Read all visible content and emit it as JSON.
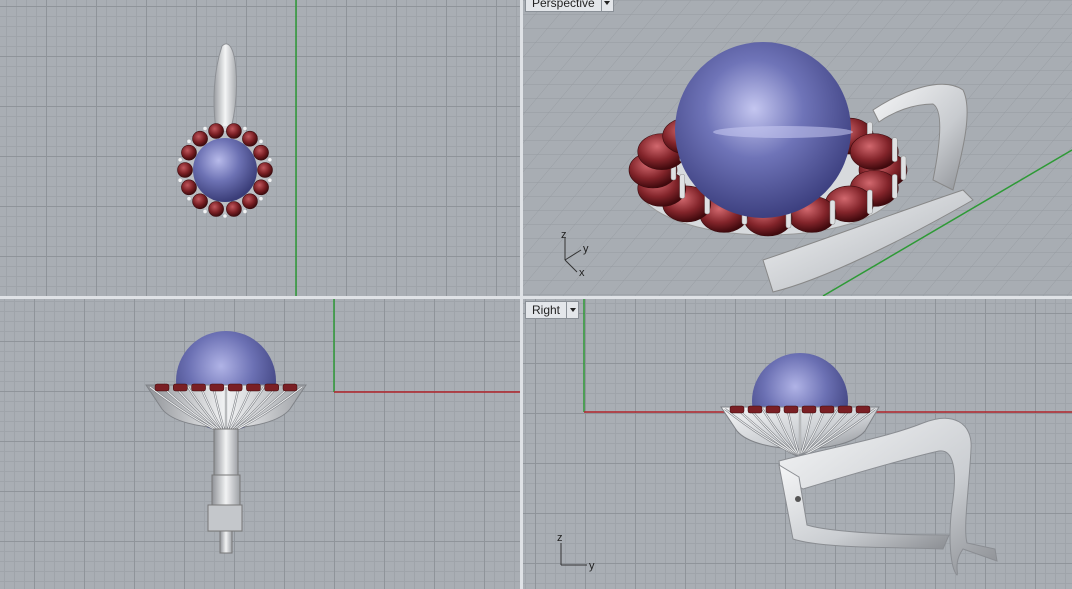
{
  "viewports": {
    "top": {
      "label": ""
    },
    "perspective": {
      "label": "Perspective"
    },
    "front": {
      "label": ""
    },
    "right": {
      "label": "Right"
    }
  },
  "axis_widgets": {
    "perspective": {
      "z": "z",
      "y": "y",
      "x": "x"
    },
    "right": {
      "z": "z",
      "y": "y"
    }
  },
  "colors": {
    "grid_bg": "#a9aeb4",
    "x_axis": "#b0232a",
    "y_axis": "#2e9a36",
    "pearl": "#6a6fb0",
    "garnet": "#7a1f24",
    "metal": "#e6e8ea"
  },
  "icons": [
    "dropdown-arrow-icon",
    "axis-triad-icon"
  ]
}
